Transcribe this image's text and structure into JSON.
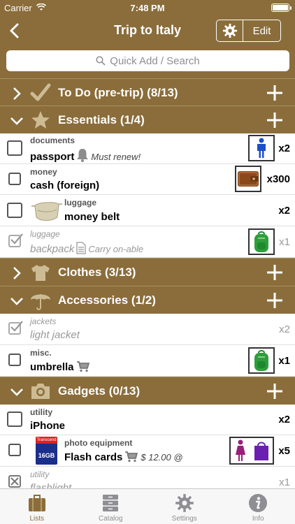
{
  "status_bar": {
    "carrier": "Carrier",
    "time": "7:48 PM"
  },
  "nav": {
    "title": "Trip to Italy",
    "edit_label": "Edit"
  },
  "search": {
    "placeholder": "Quick Add / Search"
  },
  "sections": {
    "todo": {
      "title": "To Do (pre-trip) (8/13)"
    },
    "essentials": {
      "title": "Essentials (1/4)"
    },
    "clothes": {
      "title": "Clothes (3/13)"
    },
    "accessories": {
      "title": "Accessories (1/2)"
    },
    "gadgets": {
      "title": "Gadgets (0/13)"
    }
  },
  "items": {
    "passport": {
      "category": "documents",
      "name": "passport",
      "note": "Must renew!",
      "qty": "x2"
    },
    "cash": {
      "category": "money",
      "name": "cash (foreign)",
      "qty": "x300"
    },
    "money_belt": {
      "category": "luggage",
      "name": "money belt",
      "qty": "x2"
    },
    "backpack": {
      "category": "luggage",
      "name": "backpack",
      "note": "Carry on-able",
      "qty": "x1"
    },
    "light_jacket": {
      "category": "jackets",
      "name": "light jacket",
      "qty": "x2"
    },
    "umbrella": {
      "category": "misc.",
      "name": "umbrella",
      "qty": "x1"
    },
    "iphone": {
      "category": "utility",
      "name": "iPhone",
      "qty": "x2"
    },
    "flash_cards": {
      "category": "photo equipment",
      "name": "Flash cards",
      "price": "$ 12.00 @",
      "qty": "x5",
      "card_brand": "Transcend",
      "card_size": "16GB"
    },
    "flashlight": {
      "category": "utility",
      "name": "flashlight",
      "qty": "x1"
    }
  },
  "tabbar": {
    "lists": "Lists",
    "catalog": "Catalog",
    "settings": "Settings",
    "info": "Info"
  },
  "colors": {
    "brand": "#8a6d3b",
    "accent_green": "#2e9e3a",
    "accent_purple": "#6a1fb0"
  }
}
